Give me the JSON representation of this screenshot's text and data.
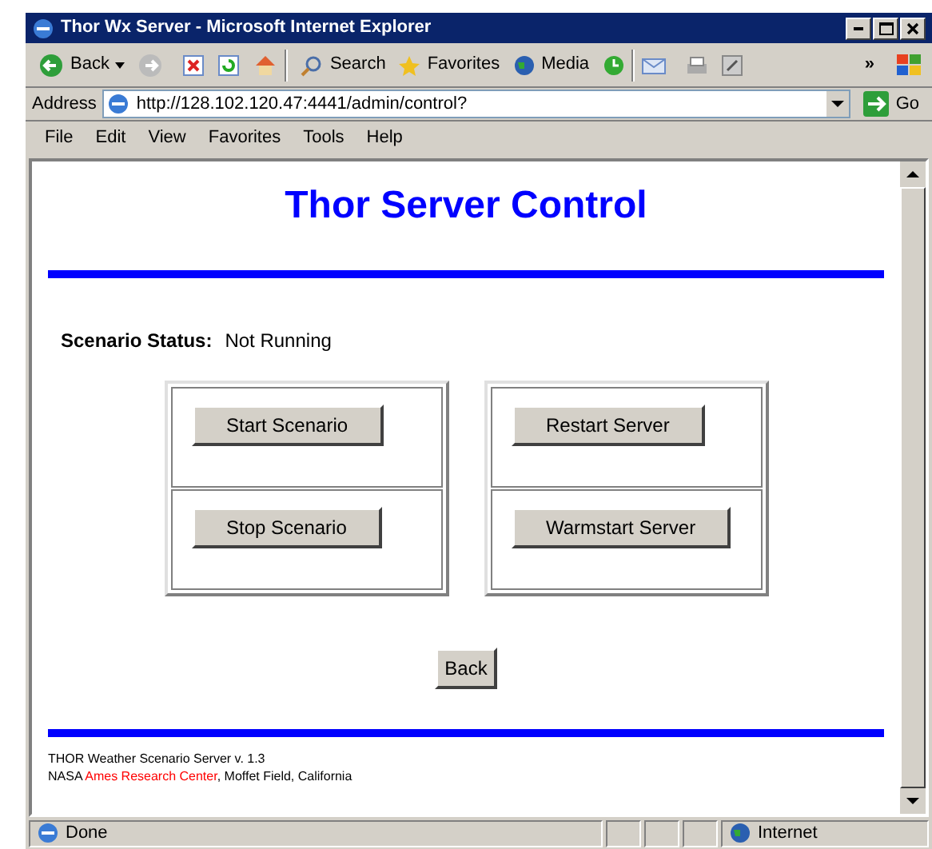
{
  "window": {
    "title": "Thor Wx Server - Microsoft Internet Explorer"
  },
  "toolbar": {
    "back": "Back",
    "search": "Search",
    "favorites": "Favorites",
    "media": "Media",
    "more": "»"
  },
  "address_bar": {
    "label": "Address",
    "url": "http://128.102.120.47:4441/admin/control?",
    "go": "Go"
  },
  "menu": [
    "File",
    "Edit",
    "View",
    "Favorites",
    "Tools",
    "Help"
  ],
  "page": {
    "heading": "Thor Server Control",
    "status_label": "Scenario Status:",
    "status_value": "Not Running",
    "button_groups": [
      [
        "Start Scenario",
        "Stop Scenario"
      ],
      [
        "Restart Server",
        "Warmstart Server"
      ]
    ],
    "back_button": "Back",
    "footer": {
      "line1": "THOR Weather Scenario Server v. 1.3",
      "line2_prefix": "NASA",
      "line2_link": "Ames Research Center",
      "line2_suffix": ", Moffet Field, California"
    }
  },
  "status_bar": {
    "text": "Done",
    "zone": "Internet"
  }
}
